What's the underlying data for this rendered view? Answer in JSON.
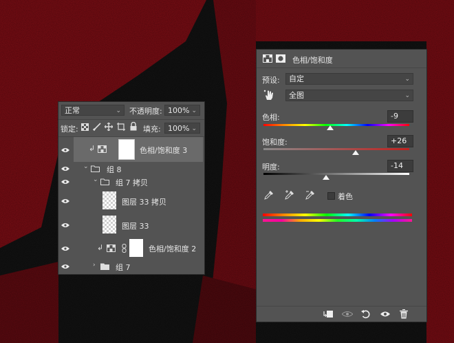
{
  "layers_panel": {
    "blend_mode": "正常",
    "opacity_label": "不透明度:",
    "opacity_value": "100%",
    "lock_label": "锁定:",
    "fill_label": "填充:",
    "fill_value": "100%",
    "layers": [
      {
        "name": "色相/饱和度 3"
      },
      {
        "name": "组 8"
      },
      {
        "name": "组 7 拷贝"
      },
      {
        "name": "图层 33 拷贝"
      },
      {
        "name": "图层 33"
      },
      {
        "name": "色相/饱和度 2"
      },
      {
        "name": "组 7"
      }
    ]
  },
  "properties_panel": {
    "title": "色相/饱和度",
    "preset_label": "预设:",
    "preset_value": "自定",
    "channel_value": "全图",
    "hue_label": "色相:",
    "hue_value": "-9",
    "saturation_label": "饱和度:",
    "saturation_value": "+26",
    "lightness_label": "明度:",
    "lightness_value": "-14",
    "colorize_label": "着色"
  },
  "colors": {
    "panel_bg": "#535353",
    "canvas_red": "#7a0d14",
    "selected_row": "#6a6a6a"
  }
}
